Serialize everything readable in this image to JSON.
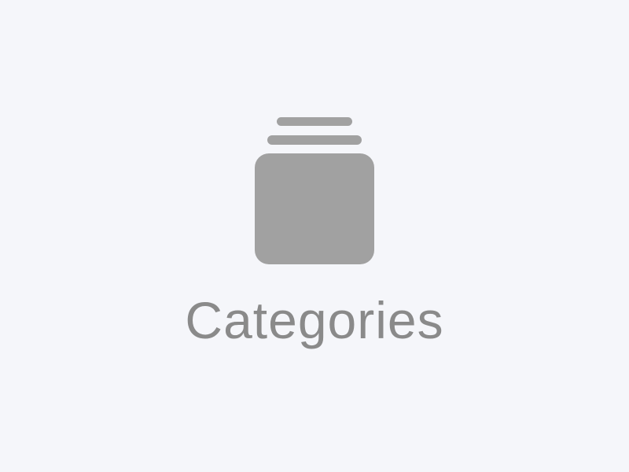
{
  "empty_state": {
    "icon": "categories-stack-icon",
    "label": "Categories"
  },
  "colors": {
    "background": "#f5f6fa",
    "icon": "#a1a1a1",
    "label": "#8a8a8a"
  }
}
